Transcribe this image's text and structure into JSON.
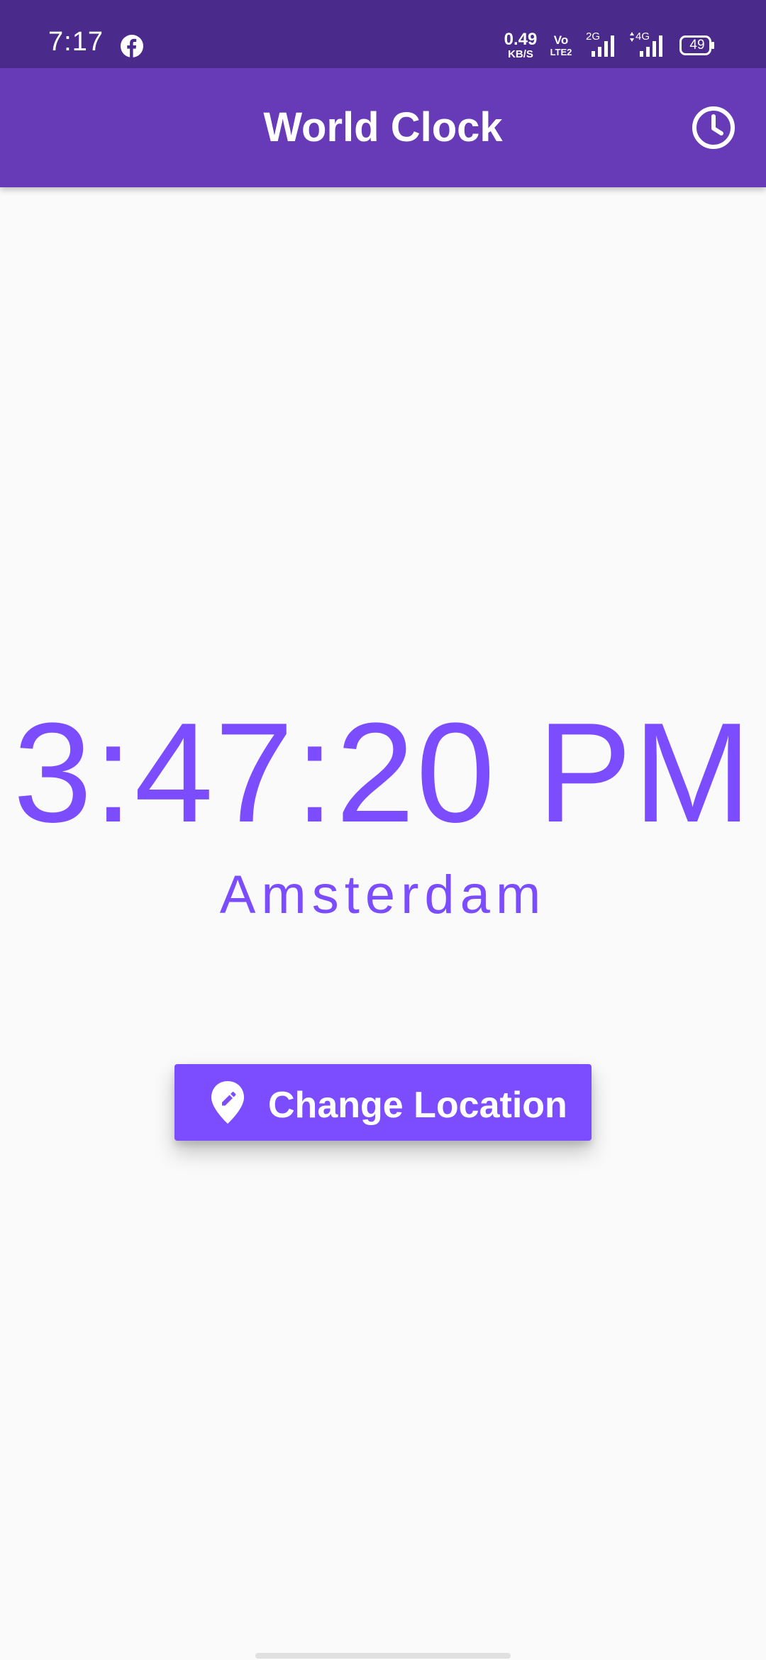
{
  "status_bar": {
    "time": "7:17",
    "notification_icon": "facebook-icon",
    "net_speed_value": "0.49",
    "net_speed_unit": "KB/S",
    "volte_top": "Vo",
    "volte_bottom": "LTE2",
    "signal_1_label": "2G",
    "signal_2_label": "4G",
    "battery_level": "49"
  },
  "app_bar": {
    "title": "World Clock",
    "action_icon": "clock-icon"
  },
  "main": {
    "time": "3:47:20 PM",
    "location": "Amsterdam",
    "change_location": {
      "label": "Change Location",
      "icon": "edit-location-icon"
    }
  },
  "colors": {
    "status_bar": "#4a2b8c",
    "app_bar": "#673ab7",
    "accent": "#7c4dff",
    "background": "#fafafa",
    "on_primary": "#ffffff"
  }
}
